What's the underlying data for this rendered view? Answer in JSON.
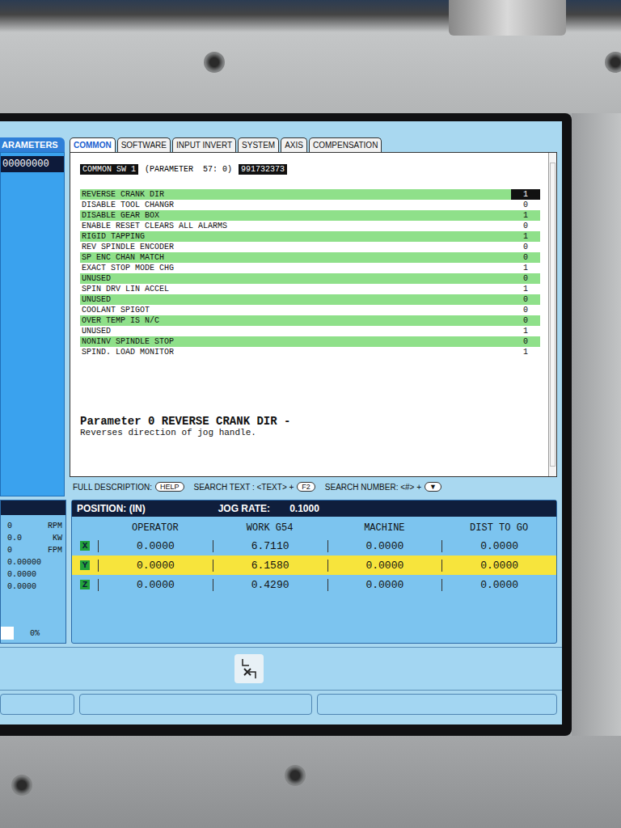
{
  "left_panel": {
    "tab": "ARAMETERS",
    "value": "00000000"
  },
  "tabs": [
    {
      "label": "COMMON",
      "selected": true
    },
    {
      "label": "SOFTWARE",
      "selected": false
    },
    {
      "label": "INPUT INVERT",
      "selected": false
    },
    {
      "label": "SYSTEM",
      "selected": false
    },
    {
      "label": "AXIS",
      "selected": false
    },
    {
      "label": "COMPENSATION",
      "selected": false
    }
  ],
  "parameter_header": {
    "name": "COMMON SW 1",
    "parameter": "(PARAMETER  57: 0)",
    "value": "991732373"
  },
  "parameters": [
    {
      "label": "REVERSE CRANK DIR",
      "value": "1",
      "selected": true
    },
    {
      "label": "DISABLE TOOL CHANGR",
      "value": "0",
      "selected": false
    },
    {
      "label": "DISABLE GEAR BOX",
      "value": "1",
      "selected": false
    },
    {
      "label": "ENABLE RESET CLEARS ALL ALARMS",
      "value": "0",
      "selected": false
    },
    {
      "label": "RIGID TAPPING",
      "value": "1",
      "selected": false
    },
    {
      "label": "REV SPINDLE ENCODER",
      "value": "0",
      "selected": false
    },
    {
      "label": "SP ENC CHAN MATCH",
      "value": "0",
      "selected": false
    },
    {
      "label": "EXACT STOP MODE CHG",
      "value": "1",
      "selected": false
    },
    {
      "label": "UNUSED",
      "value": "0",
      "selected": false
    },
    {
      "label": "SPIN DRV LIN ACCEL",
      "value": "1",
      "selected": false
    },
    {
      "label": "UNUSED",
      "value": "0",
      "selected": false
    },
    {
      "label": "COOLANT SPIGOT",
      "value": "0",
      "selected": false
    },
    {
      "label": "OVER TEMP IS N/C",
      "value": "0",
      "selected": false
    },
    {
      "label": "UNUSED",
      "value": "1",
      "selected": false
    },
    {
      "label": "NONINV SPINDLE STOP",
      "value": "0",
      "selected": false
    },
    {
      "label": "SPIND. LOAD MONITOR",
      "value": "1",
      "selected": false
    }
  ],
  "description": {
    "title": "Parameter 0 REVERSE CRANK DIR -",
    "text": "Reverses direction of jog handle."
  },
  "help_bar": [
    {
      "label": "FULL DESCRIPTION:",
      "key": "HELP"
    },
    {
      "label": "SEARCH TEXT : <TEXT> +",
      "key": "F2"
    },
    {
      "label": "SEARCH NUMBER: <#> +",
      "key": "▼"
    }
  ],
  "readouts": [
    {
      "value": "0",
      "unit": "RPM"
    },
    {
      "value": "0.0",
      "unit": "KW"
    },
    {
      "value": "0",
      "unit": "FPM"
    },
    {
      "value": "0.00000",
      "unit": ""
    },
    {
      "value": "0.0000",
      "unit": ""
    },
    {
      "value": "0.0000",
      "unit": ""
    }
  ],
  "load": "0%",
  "position": {
    "title": "POSITION: (IN)",
    "jog_label": "JOG RATE:",
    "jog_rate": "0.1000",
    "columns": [
      "OPERATOR",
      "WORK G54",
      "MACHINE",
      "DIST TO GO"
    ],
    "rows": [
      {
        "axis": "X",
        "values": [
          "0.0000",
          "6.7110",
          "0.0000",
          "0.0000"
        ],
        "selected": false
      },
      {
        "axis": "Y",
        "values": [
          "0.0000",
          "6.1580",
          "0.0000",
          "0.0000"
        ],
        "selected": true
      },
      {
        "axis": "Z",
        "values": [
          "0.0000",
          "0.4290",
          "0.0000",
          "0.0000"
        ],
        "selected": false
      }
    ]
  }
}
